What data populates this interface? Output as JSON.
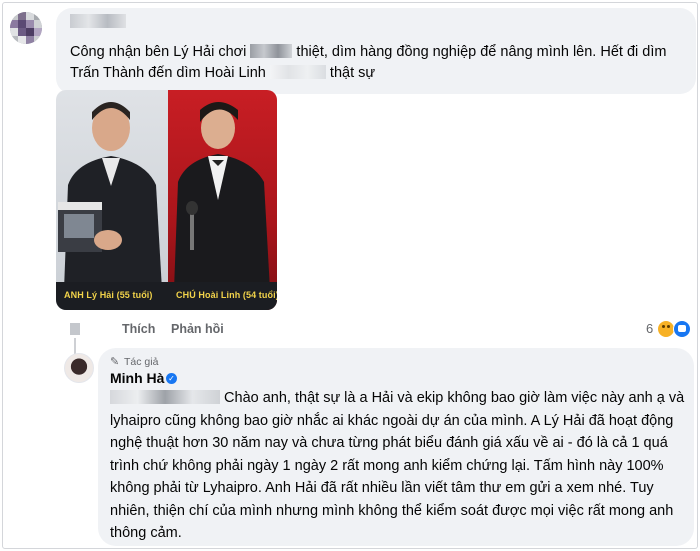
{
  "comment": {
    "text_a": "Công nhận bên Lý Hải chơi ",
    "text_b": " thiệt, dìm hàng đồng nghiệp để nâng mình lên. Hết đi dìm Trấn Thành đến dìm Hoài Linh ",
    "text_c": " thật sự",
    "image": {
      "caption_left": "ANH Lý Hải (55 tuổi)",
      "caption_right": "CHÚ Hoài Linh (54 tuổi)"
    },
    "actions": {
      "like": "Thích",
      "reply": "Phản hồi"
    },
    "reaction_count": "6",
    "reaction_icons": [
      "haha-emoji-icon",
      "like-emoji-icon"
    ]
  },
  "reply": {
    "badge": "Tác giả",
    "author": "Minh Hà",
    "text": "Chào anh, thật sự là a Hải và ekip không bao giờ làm việc này anh ạ và lyhaipro cũng không bao giờ nhắc ai khác ngoài dự án của mình. A Lý Hải đã hoạt động nghệ thuật hơn 30 năm nay và chưa từng phát biểu đánh giá xấu về ai - đó là cả 1 quá trình chứ không phải ngày 1 ngày 2 rất mong anh kiểm chứng lại. Tấm hình này 100% không phải từ Lyhaipro. Anh Hải đã rất nhiều lần viết tâm thư em gửi a xem nhé. Tuy nhiên, thiện chí của mình nhưng mình không thể kiểm soát được mọi việc rất mong anh thông cảm."
  },
  "colors": {
    "accent": "#1877f2",
    "bubble": "#f0f2f5",
    "muted": "#65676b"
  }
}
